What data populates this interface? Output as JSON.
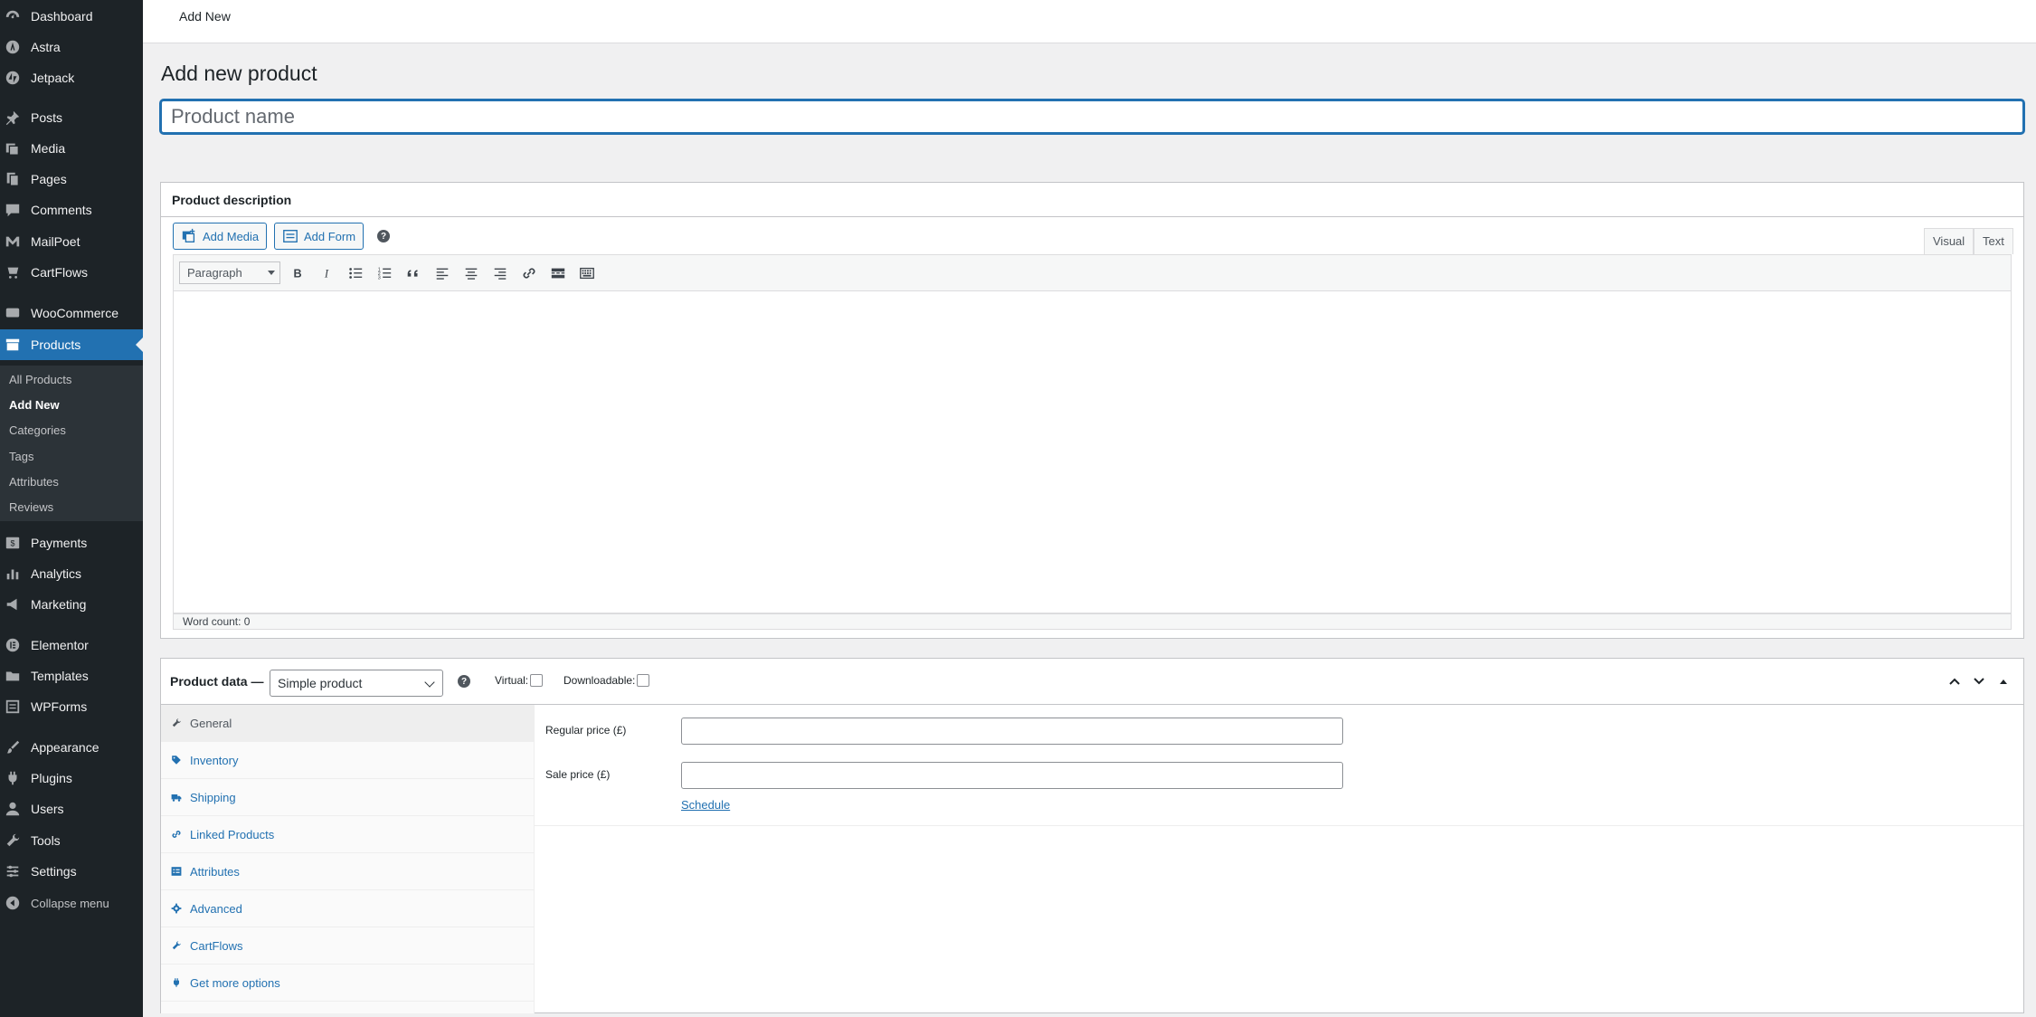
{
  "sidebar": {
    "items": [
      {
        "label": "Dashboard",
        "icon": "dashboard-icon"
      },
      {
        "label": "Astra",
        "icon": "astra-icon"
      },
      {
        "label": "Jetpack",
        "icon": "jetpack-icon"
      },
      {
        "label": "Posts",
        "icon": "pin-icon"
      },
      {
        "label": "Media",
        "icon": "media-icon"
      },
      {
        "label": "Pages",
        "icon": "pages-icon"
      },
      {
        "label": "Comments",
        "icon": "comments-icon"
      },
      {
        "label": "MailPoet",
        "icon": "mailpoet-icon"
      },
      {
        "label": "CartFlows",
        "icon": "cart-icon"
      },
      {
        "label": "WooCommerce",
        "icon": "woocommerce-icon"
      },
      {
        "label": "Products",
        "icon": "archive-icon"
      },
      {
        "label": "Payments",
        "icon": "payments-icon"
      },
      {
        "label": "Analytics",
        "icon": "analytics-icon"
      },
      {
        "label": "Marketing",
        "icon": "megaphone-icon"
      },
      {
        "label": "Elementor",
        "icon": "elementor-icon"
      },
      {
        "label": "Templates",
        "icon": "folder-icon"
      },
      {
        "label": "WPForms",
        "icon": "forms-icon"
      },
      {
        "label": "Appearance",
        "icon": "paintbrush-icon"
      },
      {
        "label": "Plugins",
        "icon": "plugin-icon"
      },
      {
        "label": "Users",
        "icon": "users-icon"
      },
      {
        "label": "Tools",
        "icon": "wrench-icon"
      },
      {
        "label": "Settings",
        "icon": "settings-icon"
      },
      {
        "label": "Collapse menu",
        "icon": "collapse-icon"
      }
    ],
    "submenu": [
      "All Products",
      "Add New",
      "Categories",
      "Tags",
      "Attributes",
      "Reviews"
    ]
  },
  "topbar": {
    "breadcrumb": "Add New"
  },
  "page": {
    "title": "Add new product",
    "title_placeholder": "Product name"
  },
  "description": {
    "header": "Product description",
    "add_media": "Add Media",
    "add_form": "Add Form",
    "tab_visual": "Visual",
    "tab_text": "Text",
    "format_select": "Paragraph",
    "word_count": "Word count: 0"
  },
  "product_data": {
    "title": "Product data —",
    "type": "Simple product",
    "virtual_label": "Virtual:",
    "downloadable_label": "Downloadable:",
    "tabs": [
      {
        "label": "General",
        "icon": "wrench-icon"
      },
      {
        "label": "Inventory",
        "icon": "tag-icon"
      },
      {
        "label": "Shipping",
        "icon": "truck-icon"
      },
      {
        "label": "Linked Products",
        "icon": "link-icon"
      },
      {
        "label": "Attributes",
        "icon": "list-icon"
      },
      {
        "label": "Advanced",
        "icon": "gear-icon"
      },
      {
        "label": "CartFlows",
        "icon": "wrench-icon"
      },
      {
        "label": "Get more options",
        "icon": "plugin-icon"
      }
    ],
    "regular_price_label": "Regular price (£)",
    "sale_price_label": "Sale price (£)",
    "regular_price": "",
    "sale_price": "",
    "schedule": "Schedule"
  },
  "colors": {
    "accent": "#2271b1",
    "sidebar_bg": "#1d2327",
    "submenu_bg": "#2c3338"
  }
}
